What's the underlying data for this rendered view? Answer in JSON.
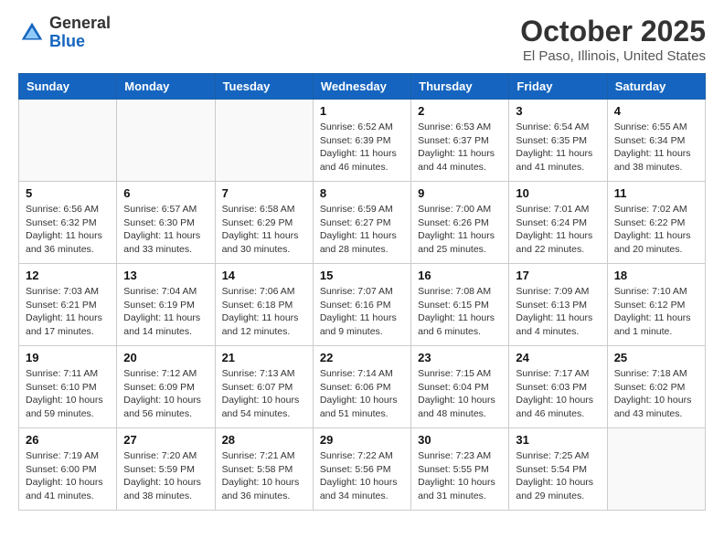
{
  "header": {
    "logo_general": "General",
    "logo_blue": "Blue",
    "month_title": "October 2025",
    "location": "El Paso, Illinois, United States"
  },
  "weekdays": [
    "Sunday",
    "Monday",
    "Tuesday",
    "Wednesday",
    "Thursday",
    "Friday",
    "Saturday"
  ],
  "weeks": [
    [
      {
        "day": "",
        "info": ""
      },
      {
        "day": "",
        "info": ""
      },
      {
        "day": "",
        "info": ""
      },
      {
        "day": "1",
        "info": "Sunrise: 6:52 AM\nSunset: 6:39 PM\nDaylight: 11 hours and 46 minutes."
      },
      {
        "day": "2",
        "info": "Sunrise: 6:53 AM\nSunset: 6:37 PM\nDaylight: 11 hours and 44 minutes."
      },
      {
        "day": "3",
        "info": "Sunrise: 6:54 AM\nSunset: 6:35 PM\nDaylight: 11 hours and 41 minutes."
      },
      {
        "day": "4",
        "info": "Sunrise: 6:55 AM\nSunset: 6:34 PM\nDaylight: 11 hours and 38 minutes."
      }
    ],
    [
      {
        "day": "5",
        "info": "Sunrise: 6:56 AM\nSunset: 6:32 PM\nDaylight: 11 hours and 36 minutes."
      },
      {
        "day": "6",
        "info": "Sunrise: 6:57 AM\nSunset: 6:30 PM\nDaylight: 11 hours and 33 minutes."
      },
      {
        "day": "7",
        "info": "Sunrise: 6:58 AM\nSunset: 6:29 PM\nDaylight: 11 hours and 30 minutes."
      },
      {
        "day": "8",
        "info": "Sunrise: 6:59 AM\nSunset: 6:27 PM\nDaylight: 11 hours and 28 minutes."
      },
      {
        "day": "9",
        "info": "Sunrise: 7:00 AM\nSunset: 6:26 PM\nDaylight: 11 hours and 25 minutes."
      },
      {
        "day": "10",
        "info": "Sunrise: 7:01 AM\nSunset: 6:24 PM\nDaylight: 11 hours and 22 minutes."
      },
      {
        "day": "11",
        "info": "Sunrise: 7:02 AM\nSunset: 6:22 PM\nDaylight: 11 hours and 20 minutes."
      }
    ],
    [
      {
        "day": "12",
        "info": "Sunrise: 7:03 AM\nSunset: 6:21 PM\nDaylight: 11 hours and 17 minutes."
      },
      {
        "day": "13",
        "info": "Sunrise: 7:04 AM\nSunset: 6:19 PM\nDaylight: 11 hours and 14 minutes."
      },
      {
        "day": "14",
        "info": "Sunrise: 7:06 AM\nSunset: 6:18 PM\nDaylight: 11 hours and 12 minutes."
      },
      {
        "day": "15",
        "info": "Sunrise: 7:07 AM\nSunset: 6:16 PM\nDaylight: 11 hours and 9 minutes."
      },
      {
        "day": "16",
        "info": "Sunrise: 7:08 AM\nSunset: 6:15 PM\nDaylight: 11 hours and 6 minutes."
      },
      {
        "day": "17",
        "info": "Sunrise: 7:09 AM\nSunset: 6:13 PM\nDaylight: 11 hours and 4 minutes."
      },
      {
        "day": "18",
        "info": "Sunrise: 7:10 AM\nSunset: 6:12 PM\nDaylight: 11 hours and 1 minute."
      }
    ],
    [
      {
        "day": "19",
        "info": "Sunrise: 7:11 AM\nSunset: 6:10 PM\nDaylight: 10 hours and 59 minutes."
      },
      {
        "day": "20",
        "info": "Sunrise: 7:12 AM\nSunset: 6:09 PM\nDaylight: 10 hours and 56 minutes."
      },
      {
        "day": "21",
        "info": "Sunrise: 7:13 AM\nSunset: 6:07 PM\nDaylight: 10 hours and 54 minutes."
      },
      {
        "day": "22",
        "info": "Sunrise: 7:14 AM\nSunset: 6:06 PM\nDaylight: 10 hours and 51 minutes."
      },
      {
        "day": "23",
        "info": "Sunrise: 7:15 AM\nSunset: 6:04 PM\nDaylight: 10 hours and 48 minutes."
      },
      {
        "day": "24",
        "info": "Sunrise: 7:17 AM\nSunset: 6:03 PM\nDaylight: 10 hours and 46 minutes."
      },
      {
        "day": "25",
        "info": "Sunrise: 7:18 AM\nSunset: 6:02 PM\nDaylight: 10 hours and 43 minutes."
      }
    ],
    [
      {
        "day": "26",
        "info": "Sunrise: 7:19 AM\nSunset: 6:00 PM\nDaylight: 10 hours and 41 minutes."
      },
      {
        "day": "27",
        "info": "Sunrise: 7:20 AM\nSunset: 5:59 PM\nDaylight: 10 hours and 38 minutes."
      },
      {
        "day": "28",
        "info": "Sunrise: 7:21 AM\nSunset: 5:58 PM\nDaylight: 10 hours and 36 minutes."
      },
      {
        "day": "29",
        "info": "Sunrise: 7:22 AM\nSunset: 5:56 PM\nDaylight: 10 hours and 34 minutes."
      },
      {
        "day": "30",
        "info": "Sunrise: 7:23 AM\nSunset: 5:55 PM\nDaylight: 10 hours and 31 minutes."
      },
      {
        "day": "31",
        "info": "Sunrise: 7:25 AM\nSunset: 5:54 PM\nDaylight: 10 hours and 29 minutes."
      },
      {
        "day": "",
        "info": ""
      }
    ]
  ]
}
